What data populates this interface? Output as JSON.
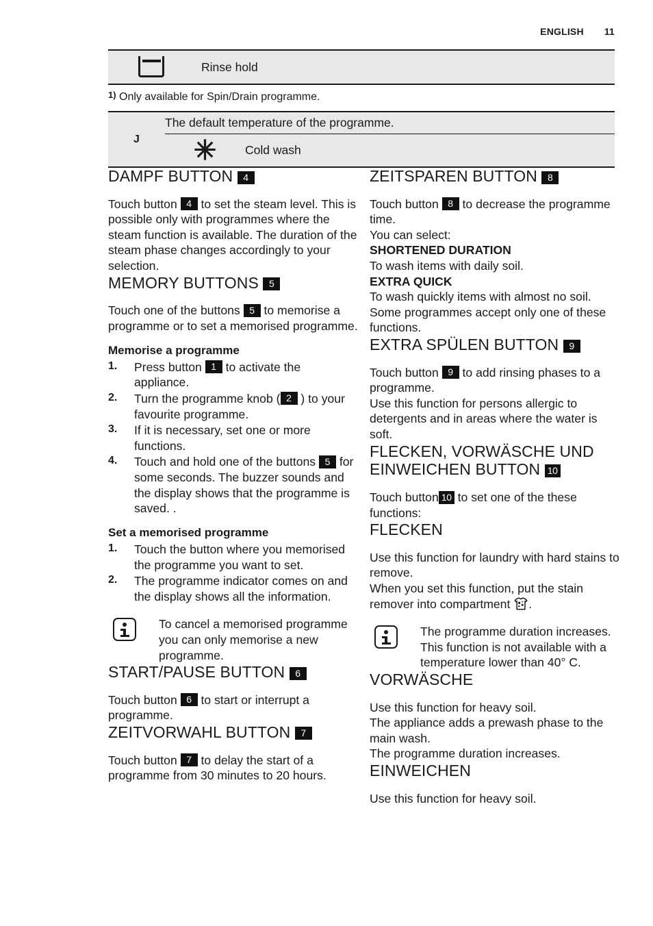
{
  "header": {
    "language": "ENGLISH",
    "page_number": "11"
  },
  "table_rinse_hold": {
    "icon": "rinse-hold-icon",
    "label": "Rinse hold"
  },
  "footnote": {
    "marker": "1)",
    "text": "Only available for Spin/Drain programme."
  },
  "table_temperature": {
    "letter": "J",
    "default_row": "The default temperature of the programme.",
    "cold_icon": "snowflake-icon",
    "cold_label": "Cold wash"
  },
  "left_column": {
    "dampf": {
      "heading": "DAMPF BUTTON",
      "heading_badge": "4",
      "para_pre": "Touch button",
      "badge": "4",
      "para_post": "to set the steam level. This is possible only with programmes where the steam function is available. The duration of the steam phase changes accordingly to your selection."
    },
    "memory": {
      "heading": "MEMORY BUTTONS",
      "heading_badge": "5",
      "para_pre": "Touch one of the buttons",
      "badge": "5",
      "para_post": "to memorise a programme or to set a memorised programme.",
      "sub_memorise": "Memorise a programme",
      "steps_memorise": [
        {
          "num": "1.",
          "pre": "Press button",
          "badge": "1",
          "post": "to activate the appliance."
        },
        {
          "num": "2.",
          "pre": "Turn the programme knob (",
          "badge": "2",
          "post": ") to your favourite programme."
        },
        {
          "num": "3.",
          "pre": "If it is necessary, set one or more functions.",
          "badge": "",
          "post": ""
        },
        {
          "num": "4.",
          "pre": "Touch and hold one of the buttons",
          "badge": "5",
          "post": "for some seconds. The buzzer sounds and the display shows that the programme is saved. ."
        }
      ],
      "sub_set": "Set a memorised programme",
      "steps_set": [
        {
          "num": "1.",
          "pre": "Touch the button where you memorised the programme you want to set.",
          "badge": "",
          "post": ""
        },
        {
          "num": "2.",
          "pre": "The programme indicator comes on and the display shows all the information.",
          "badge": "",
          "post": ""
        }
      ],
      "note": "To cancel a memorised programme you can only memorise a new programme."
    },
    "start_pause": {
      "heading": "START/PAUSE BUTTON",
      "heading_badge": "6",
      "para_pre": "Touch button",
      "badge": "6",
      "para_post": "to start or interrupt a programme."
    },
    "zeitvorwahl": {
      "heading": "ZEITVORWAHL BUTTON",
      "heading_badge": "7",
      "para_pre": "Touch button",
      "badge": "7",
      "para_post": "to delay the start of a programme from 30 minutes to 20 hours."
    }
  },
  "right_column": {
    "zeitsparen": {
      "heading": "ZEITSPAREN BUTTON",
      "heading_badge": "8",
      "para_pre": "Touch button",
      "badge": "8",
      "para_post": "to decrease the programme time.",
      "line_select": "You can select:",
      "bold_1": "SHORTENED DURATION",
      "text_1": "To wash items with daily soil.",
      "bold_2": "EXTRA QUICK",
      "text_2": "To wash quickly items with almost no soil. Some programmes accept only one of these functions."
    },
    "extra_spulen": {
      "heading": "EXTRA SPÜLEN BUTTON",
      "heading_badge": "9",
      "para_pre": "Touch button",
      "badge": "9",
      "para_post": "to add rinsing phases to a programme.",
      "para_2": "Use this function for persons allergic to detergents and in areas where the water is soft."
    },
    "flecken_group": {
      "heading_line1": "FLECKEN, VORWÄSCHE UND",
      "heading_line2": "EINWEICHEN BUTTON",
      "heading_badge": "10",
      "para_pre": "Touch button",
      "badge": "10",
      "para_post": "to set one of the these functions:"
    },
    "flecken": {
      "heading": "FLECKEN",
      "para_1": "Use this function for laundry with hard stains to remove.",
      "para_2_pre": "When you set this function, put the stain remover into compartment",
      "icon": "stained-shirt-icon",
      "para_2_post": ".",
      "note": "The programme duration increases. This function is not available with a temperature lower than 40° C."
    },
    "vorwasche": {
      "heading": "VORWÄSCHE",
      "para_1": "Use this function for heavy soil.",
      "para_2": "The appliance adds a prewash phase to the main wash.",
      "para_3": "The programme duration increases."
    },
    "einweichen": {
      "heading": "EINWEICHEN",
      "para_1": "Use this function for heavy soil."
    }
  },
  "colors": {
    "table_bg": "#e8e8e8",
    "rule": "#1a1a1a",
    "badge_bg": "#111111",
    "text": "#1a1a1a"
  }
}
